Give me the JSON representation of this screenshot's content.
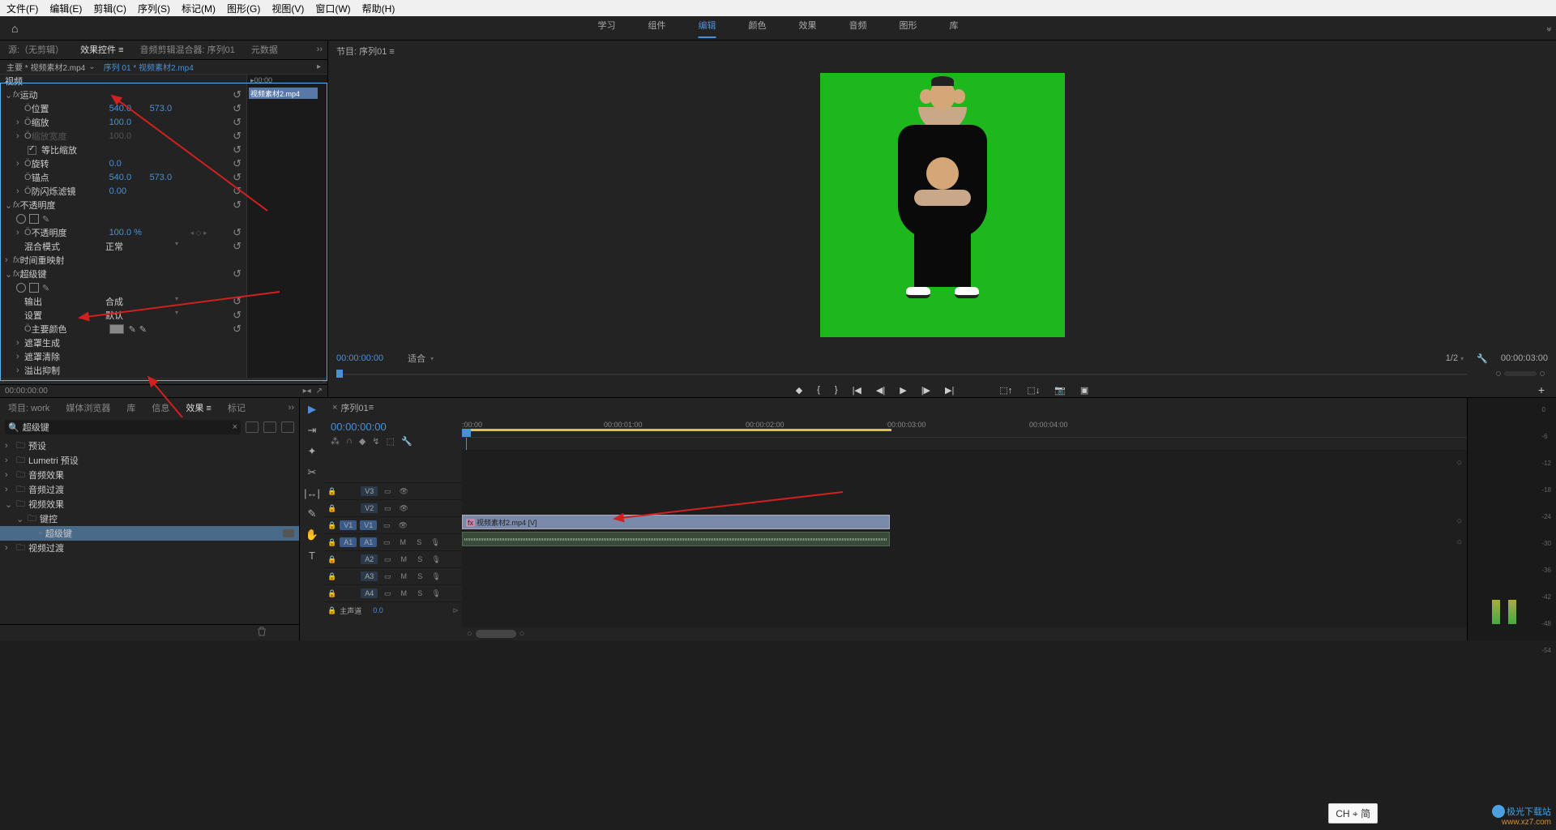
{
  "menubar": [
    "文件(F)",
    "编辑(E)",
    "剪辑(C)",
    "序列(S)",
    "标记(M)",
    "图形(G)",
    "视图(V)",
    "窗口(W)",
    "帮助(H)"
  ],
  "topnav": {
    "tabs": [
      "学习",
      "组件",
      "编辑",
      "颜色",
      "效果",
      "音频",
      "图形",
      "库"
    ],
    "active": "编辑"
  },
  "effect_panel": {
    "tabs": [
      "源:（无剪辑）",
      "效果控件",
      "音频剪辑混合器: 序列01",
      "元数据"
    ],
    "active_tab": "效果控件",
    "breadcrumb1": "主要 * 视频素材2.mp4",
    "breadcrumb2": "序列 01 * 视频素材2.mp4",
    "timeline_tc": "00:00",
    "timeline_clip": "视频素材2.mp4",
    "groups": [
      {
        "type": "section",
        "label": "视频"
      },
      {
        "type": "fx",
        "label": "运动",
        "expanded": true,
        "reset": true
      },
      {
        "type": "prop",
        "label": "位置",
        "v1": "540.0",
        "v2": "573.0",
        "stopwatch": true,
        "reset": true,
        "indent": 1
      },
      {
        "type": "prop",
        "label": "缩放",
        "v1": "100.0",
        "stopwatch": true,
        "reset": true,
        "chev": true,
        "indent": 1
      },
      {
        "type": "prop",
        "label": "缩放宽度",
        "v1": "100.0",
        "dim": true,
        "reset": true,
        "chev": true,
        "indent": 1
      },
      {
        "type": "check",
        "label": "等比缩放",
        "checked": true,
        "reset": true,
        "indent": 2
      },
      {
        "type": "prop",
        "label": "旋转",
        "v1": "0.0",
        "stopwatch": true,
        "reset": true,
        "chev": true,
        "indent": 1
      },
      {
        "type": "prop",
        "label": "锚点",
        "v1": "540.0",
        "v2": "573.0",
        "stopwatch": true,
        "reset": true,
        "indent": 1
      },
      {
        "type": "prop",
        "label": "防闪烁滤镜",
        "v1": "0.00",
        "stopwatch": true,
        "reset": true,
        "chev": true,
        "indent": 1
      },
      {
        "type": "fx",
        "label": "不透明度",
        "expanded": true,
        "reset": true
      },
      {
        "type": "mask",
        "indent": 1
      },
      {
        "type": "prop",
        "label": "不透明度",
        "v1": "100.0 %",
        "stopwatch": true,
        "reset": true,
        "chev": true,
        "kf": true,
        "indent": 1
      },
      {
        "type": "dropdown",
        "label": "混合模式",
        "v1": "正常",
        "reset": true,
        "indent": 1
      },
      {
        "type": "fx",
        "label": "时间重映射",
        "expanded": false
      },
      {
        "type": "fx",
        "label": "超级键",
        "expanded": true,
        "reset": true
      },
      {
        "type": "mask",
        "indent": 1
      },
      {
        "type": "dropdown",
        "label": "输出",
        "v1": "合成",
        "reset": true,
        "indent": 1
      },
      {
        "type": "dropdown",
        "label": "设置",
        "v1": "默认",
        "reset": true,
        "indent": 1
      },
      {
        "type": "color",
        "label": "主要颜色",
        "stopwatch": true,
        "reset": true,
        "indent": 1
      },
      {
        "type": "sub",
        "label": "遮罩生成",
        "chev": true,
        "indent": 1
      },
      {
        "type": "sub",
        "label": "遮罩清除",
        "chev": true,
        "indent": 1
      },
      {
        "type": "sub",
        "label": "溢出抑制",
        "chev": true,
        "indent": 1
      }
    ],
    "footer_tc": "00:00:00:00"
  },
  "monitor": {
    "tab": "节目: 序列01",
    "tc_left": "00:00:00:00",
    "fit": "适合",
    "zoom": "1/2",
    "tc_right": "00:00:03:00"
  },
  "project": {
    "tabs": [
      "项目: work",
      "媒体浏览器",
      "库",
      "信息",
      "效果",
      "标记"
    ],
    "active_tab": "效果",
    "search": "超级键",
    "tree": [
      {
        "chev": "›",
        "icon": "folder",
        "label": "预设",
        "indent": 0
      },
      {
        "chev": "›",
        "icon": "folder",
        "label": "Lumetri 预设",
        "indent": 0
      },
      {
        "chev": "›",
        "icon": "folder",
        "label": "音频效果",
        "indent": 0
      },
      {
        "chev": "›",
        "icon": "folder",
        "label": "音频过渡",
        "indent": 0
      },
      {
        "chev": "⌄",
        "icon": "folder",
        "label": "视频效果",
        "indent": 0
      },
      {
        "chev": "⌄",
        "icon": "folder",
        "label": "键控",
        "indent": 1
      },
      {
        "chev": "",
        "icon": "fx",
        "label": "超级键",
        "indent": 2,
        "selected": true,
        "badge": true
      },
      {
        "chev": "›",
        "icon": "folder",
        "label": "视频过渡",
        "indent": 0
      }
    ]
  },
  "timeline": {
    "tab": "序列01",
    "tc": "00:00:00:00",
    "ruler": [
      ":00:00",
      "00:00:01:00",
      "00:00:02:00",
      "00:00:03:00",
      "00:00:04:00"
    ],
    "tracks": [
      {
        "lock": true,
        "tag": "V3",
        "toggles": [
          "▭",
          "👁"
        ],
        "type": "v"
      },
      {
        "lock": true,
        "tag": "V2",
        "toggles": [
          "▭",
          "👁"
        ],
        "type": "v"
      },
      {
        "lock": true,
        "src": "V1",
        "tag": "V1",
        "toggles": [
          "▭",
          "👁"
        ],
        "type": "v",
        "active": true
      },
      {
        "lock": true,
        "src": "A1",
        "tag": "A1",
        "toggles": [
          "▭",
          "M",
          "S",
          "🎙"
        ],
        "type": "a",
        "active": true
      },
      {
        "lock": true,
        "tag": "A2",
        "toggles": [
          "▭",
          "M",
          "S",
          "🎙"
        ],
        "type": "a"
      },
      {
        "lock": true,
        "tag": "A3",
        "toggles": [
          "▭",
          "M",
          "S",
          "🎙"
        ],
        "type": "a"
      },
      {
        "lock": true,
        "tag": "A4",
        "toggles": [
          "▭",
          "M",
          "S",
          "🎙"
        ],
        "type": "a"
      },
      {
        "lock": true,
        "tag": "主声道",
        "val": "0.0",
        "type": "master"
      }
    ],
    "clip_v": "视频素材2.mp4 [V]",
    "clip_v_fx": "fx"
  },
  "audio_scale": [
    "0",
    "-6",
    "-12",
    "-18",
    "-24",
    "-30",
    "-36",
    "-42",
    "-48",
    "-54"
  ],
  "ime": "CH ⌖ 简",
  "watermark": {
    "line1": "极光下载站",
    "line2": "www.xz7.com"
  }
}
